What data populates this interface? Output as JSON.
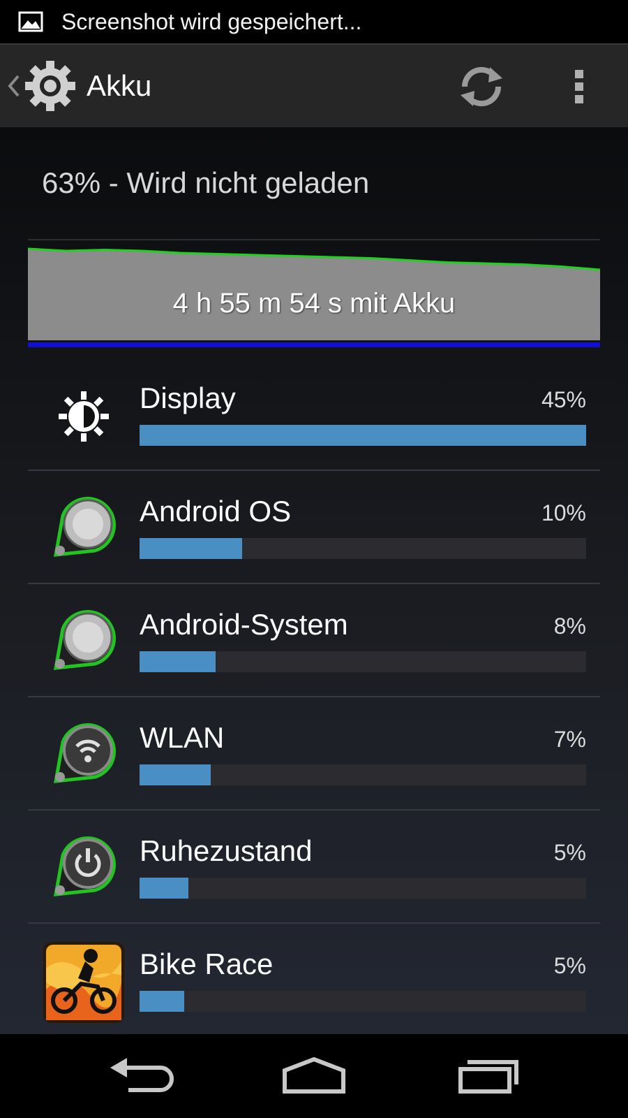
{
  "status_bar": {
    "notification_text": "Screenshot wird gespeichert...",
    "icon": "image-icon"
  },
  "action_bar": {
    "title": "Akku",
    "icon": "settings-gear-icon",
    "actions": [
      "refresh-icon",
      "overflow-menu-icon"
    ]
  },
  "battery": {
    "status_text": "63% - Wird nicht geladen",
    "graph_caption": "4 h 55 m 54 s mit Akku",
    "level_series": [
      92,
      90,
      91,
      90,
      88,
      87,
      86,
      85,
      84,
      83,
      81,
      79,
      78,
      77,
      75,
      72
    ],
    "colors": {
      "graph_fill": "#8c8c8c",
      "graph_line": "#1fd21f",
      "charge_bar": "#1010d0",
      "usage_bar": "#4a8fc4"
    }
  },
  "usage_list": [
    {
      "name": "Display",
      "percent_label": "45%",
      "bar_fraction": 1.0,
      "icon": "brightness-icon"
    },
    {
      "name": "Android OS",
      "percent_label": "10%",
      "bar_fraction": 0.23,
      "icon": "android-os-icon"
    },
    {
      "name": "Android-System",
      "percent_label": "8%",
      "bar_fraction": 0.17,
      "icon": "android-system-icon"
    },
    {
      "name": "WLAN",
      "percent_label": "7%",
      "bar_fraction": 0.16,
      "icon": "wifi-icon"
    },
    {
      "name": "Ruhezustand",
      "percent_label": "5%",
      "bar_fraction": 0.11,
      "icon": "power-icon"
    },
    {
      "name": "Bike Race",
      "percent_label": "5%",
      "bar_fraction": 0.1,
      "icon": "bike-race-app-icon"
    }
  ],
  "nav_bar": {
    "buttons": [
      "back-icon",
      "home-icon",
      "recent-apps-icon"
    ]
  }
}
